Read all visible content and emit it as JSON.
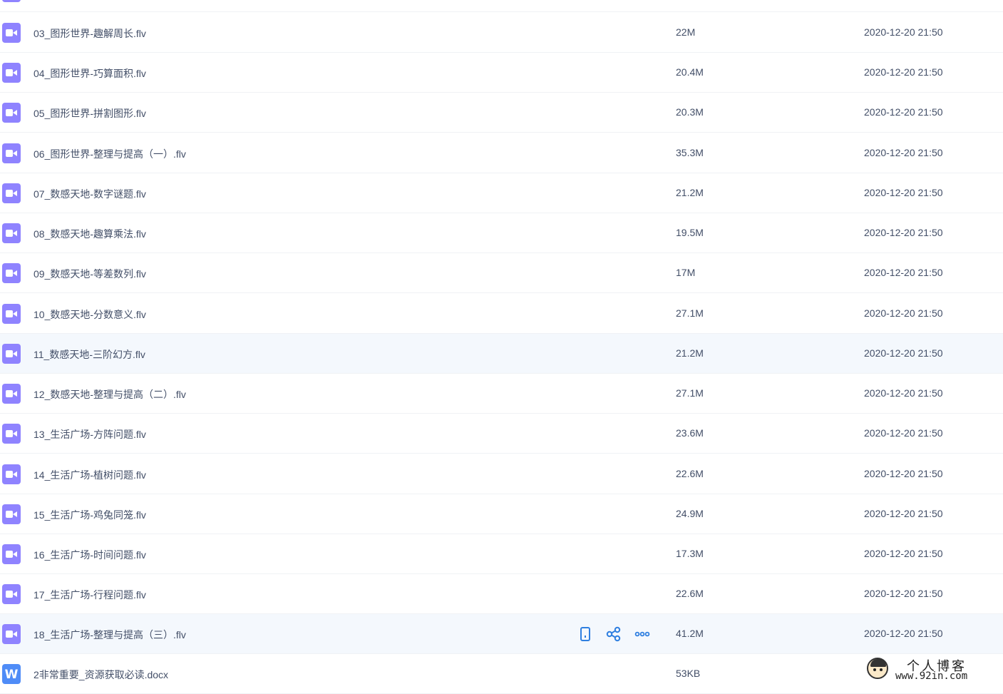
{
  "files": [
    {
      "name": "",
      "size": "",
      "date": "",
      "type": "video"
    },
    {
      "name": "03_图形世界-趣解周长.flv",
      "size": "22M",
      "date": "2020-12-20 21:50",
      "type": "video"
    },
    {
      "name": "04_图形世界-巧算面积.flv",
      "size": "20.4M",
      "date": "2020-12-20 21:50",
      "type": "video"
    },
    {
      "name": "05_图形世界-拼割图形.flv",
      "size": "20.3M",
      "date": "2020-12-20 21:50",
      "type": "video"
    },
    {
      "name": "06_图形世界-整理与提高（一）.flv",
      "size": "35.3M",
      "date": "2020-12-20 21:50",
      "type": "video"
    },
    {
      "name": "07_数感天地-数字谜题.flv",
      "size": "21.2M",
      "date": "2020-12-20 21:50",
      "type": "video"
    },
    {
      "name": "08_数感天地-趣算乘法.flv",
      "size": "19.5M",
      "date": "2020-12-20 21:50",
      "type": "video"
    },
    {
      "name": "09_数感天地-等差数列.flv",
      "size": "17M",
      "date": "2020-12-20 21:50",
      "type": "video"
    },
    {
      "name": "10_数感天地-分数意义.flv",
      "size": "27.1M",
      "date": "2020-12-20 21:50",
      "type": "video"
    },
    {
      "name": "11_数感天地-三阶幻方.flv",
      "size": "21.2M",
      "date": "2020-12-20 21:50",
      "type": "video"
    },
    {
      "name": "12_数感天地-整理与提高（二）.flv",
      "size": "27.1M",
      "date": "2020-12-20 21:50",
      "type": "video"
    },
    {
      "name": "13_生活广场-方阵问题.flv",
      "size": "23.6M",
      "date": "2020-12-20 21:50",
      "type": "video"
    },
    {
      "name": "14_生活广场-植树问题.flv",
      "size": "22.6M",
      "date": "2020-12-20 21:50",
      "type": "video"
    },
    {
      "name": "15_生活广场-鸡兔同笼.flv",
      "size": "24.9M",
      "date": "2020-12-20 21:50",
      "type": "video"
    },
    {
      "name": "16_生活广场-时间问题.flv",
      "size": "17.3M",
      "date": "2020-12-20 21:50",
      "type": "video"
    },
    {
      "name": "17_生活广场-行程问题.flv",
      "size": "22.6M",
      "date": "2020-12-20 21:50",
      "type": "video"
    },
    {
      "name": "18_生活广场-整理与提高（三）.flv",
      "size": "41.2M",
      "date": "2020-12-20 21:50",
      "type": "video"
    },
    {
      "name": "2非常重要_资源获取必读.docx",
      "size": "53KB",
      "date": "",
      "type": "word"
    }
  ],
  "word_icon_letter": "W",
  "row_actions": [
    "phone-icon",
    "share-icon",
    "more-icon"
  ],
  "colors": {
    "video_icon": "#8f83ff",
    "word_icon": "#4f8cf7",
    "action_icon": "#2f7fe0",
    "hover_row": "#f4f8fd"
  },
  "watermark": {
    "title": "个人博客",
    "url": "www.92in.com"
  }
}
